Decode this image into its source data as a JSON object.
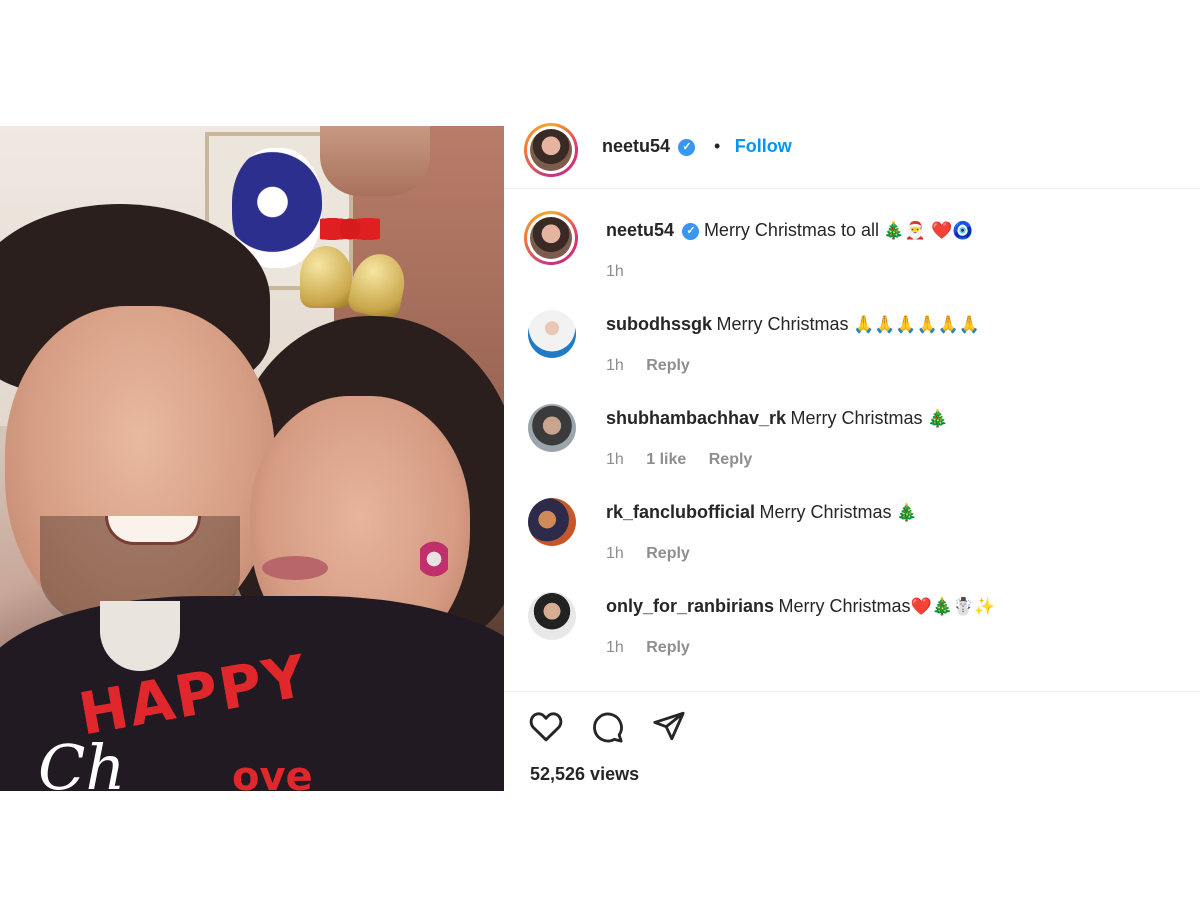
{
  "post": {
    "author": "neetu54",
    "follow_label": "Follow",
    "separator": "•",
    "verified_mark": "✓",
    "caption": {
      "username": "neetu54",
      "text": "Merry Christmas to all",
      "emojis": "🎄🎅 ❤️🧿",
      "time": "1h"
    },
    "comments": [
      {
        "username": "subodhssgk",
        "text": "Merry Christmas",
        "emojis": "🙏🙏🙏🙏🙏🙏",
        "time": "1h",
        "likes": "",
        "reply": "Reply"
      },
      {
        "username": "shubhambachhav_rk",
        "text": "Merry Christmas",
        "emojis": "🎄",
        "time": "1h",
        "likes": "1 like",
        "reply": "Reply"
      },
      {
        "username": "rk_fanclubofficial",
        "text": "Merry Christmas",
        "emojis": "🎄",
        "time": "1h",
        "likes": "",
        "reply": "Reply"
      },
      {
        "username": "only_for_ranbirians",
        "text": "Merry Christmas",
        "emojis": "❤️🎄☃️✨",
        "time": "1h",
        "likes": "",
        "reply": "Reply"
      }
    ],
    "views": "52,526 views"
  },
  "photo_overlay": {
    "happy": "HAPPY",
    "christmas": "Ch",
    "love": "ove"
  },
  "icons": [
    "heart-icon",
    "comment-icon",
    "share-icon"
  ],
  "colors": {
    "accent": "#0095f6",
    "verified": "#3897f0",
    "text": "#262626",
    "muted": "#8e8e8e"
  }
}
